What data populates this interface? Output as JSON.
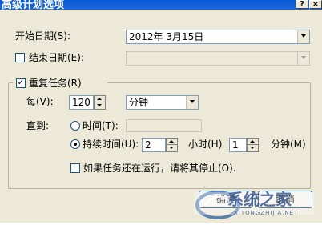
{
  "window": {
    "title": "高级计划选项",
    "help_button": "?",
    "close_button": "×"
  },
  "start_date": {
    "label": "开始日期(S):",
    "value": "2012年 3月15日"
  },
  "end_date": {
    "checkbox_checked": false,
    "label": "结束日期(E):",
    "value": ""
  },
  "repeat": {
    "checkbox_checked": true,
    "label": "重复任务(R)",
    "every_label": "每(V):",
    "every_value": "120",
    "every_unit": "分钟",
    "until_label": "直到:",
    "time_option": {
      "label": "时间(T):",
      "selected": false,
      "value": ""
    },
    "duration_option": {
      "label": "持续时间(U):",
      "selected": true,
      "hours_value": "2",
      "hours_label": "小时(H)",
      "minutes_value": "1",
      "minutes_label": "分钟(M)"
    },
    "stop_if_running": {
      "checked": false,
      "label": "如果任务还在运行，请将其停止(O)."
    }
  },
  "buttons": {
    "ok_label": "确定",
    "cancel_label": "取消"
  },
  "watermark": {
    "brand": "系统之家",
    "url": "XITONGZHIJIA.NET"
  },
  "colors": {
    "titlebar": "#0a5bd8",
    "dialog_bg": "#ece9d8",
    "field_border": "#7f9db9"
  }
}
